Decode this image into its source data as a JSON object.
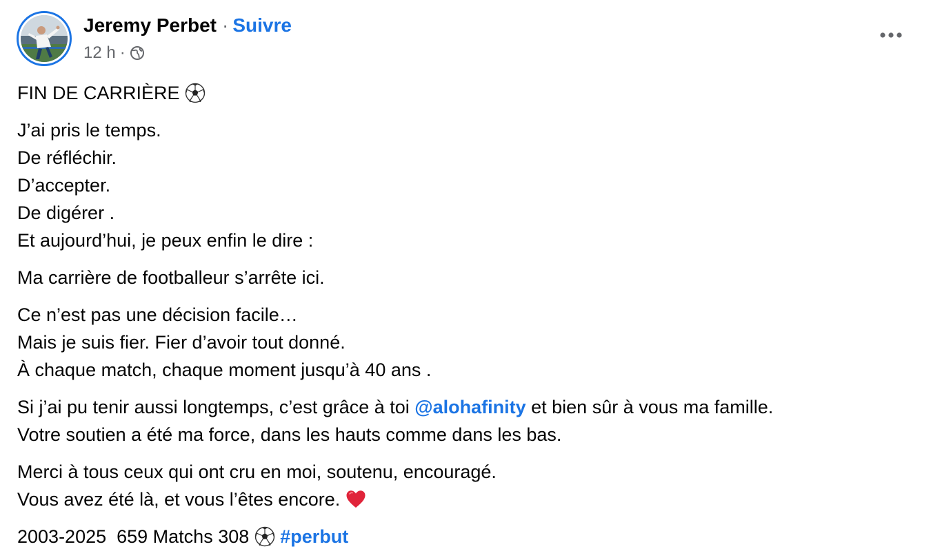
{
  "post": {
    "author": {
      "name": "Jeremy Perbet",
      "separator": "·",
      "follow_label": "Suivre"
    },
    "meta": {
      "time": "12 h",
      "separator": "·",
      "audience_icon": "globe-icon"
    },
    "menu_icon": "more-options-icon",
    "body": {
      "title": "FIN DE CARRIÈRE",
      "title_emoji": "soccer-ball",
      "para1": [
        "J’ai pris le temps.",
        "De réfléchir.",
        "D’accepter.",
        "De digérer .",
        "Et aujourd’hui, je peux enfin le dire :"
      ],
      "para2": "Ma carrière de footballeur s’arrête ici.",
      "para3": [
        "Ce n’est pas une décision facile…",
        "Mais je suis fier. Fier d’avoir tout donné.",
        "À chaque match, chaque moment jusqu’à 40 ans ."
      ],
      "para4": {
        "line1_before": "Si j’ai pu tenir aussi longtemps, c’est grâce à toi ",
        "mention": "@alohafinity",
        "line1_after": " et bien sûr à vous ma famille.",
        "line2": "Votre soutien a été ma force, dans les hauts comme dans les bas."
      },
      "para5": {
        "line1": "Merci à tous ceux qui ont cru en moi, soutenu, encouragé.",
        "line2": "Vous avez été là, et vous l’êtes encore.",
        "line2_emoji": "red-heart"
      },
      "stats": {
        "text": "2003-2025  659 Matchs 308",
        "emoji": "soccer-ball",
        "hashtag": "#perbut"
      }
    }
  },
  "colors": {
    "accent": "#1b74e4",
    "text": "#050505",
    "secondary_text": "#65676b"
  }
}
